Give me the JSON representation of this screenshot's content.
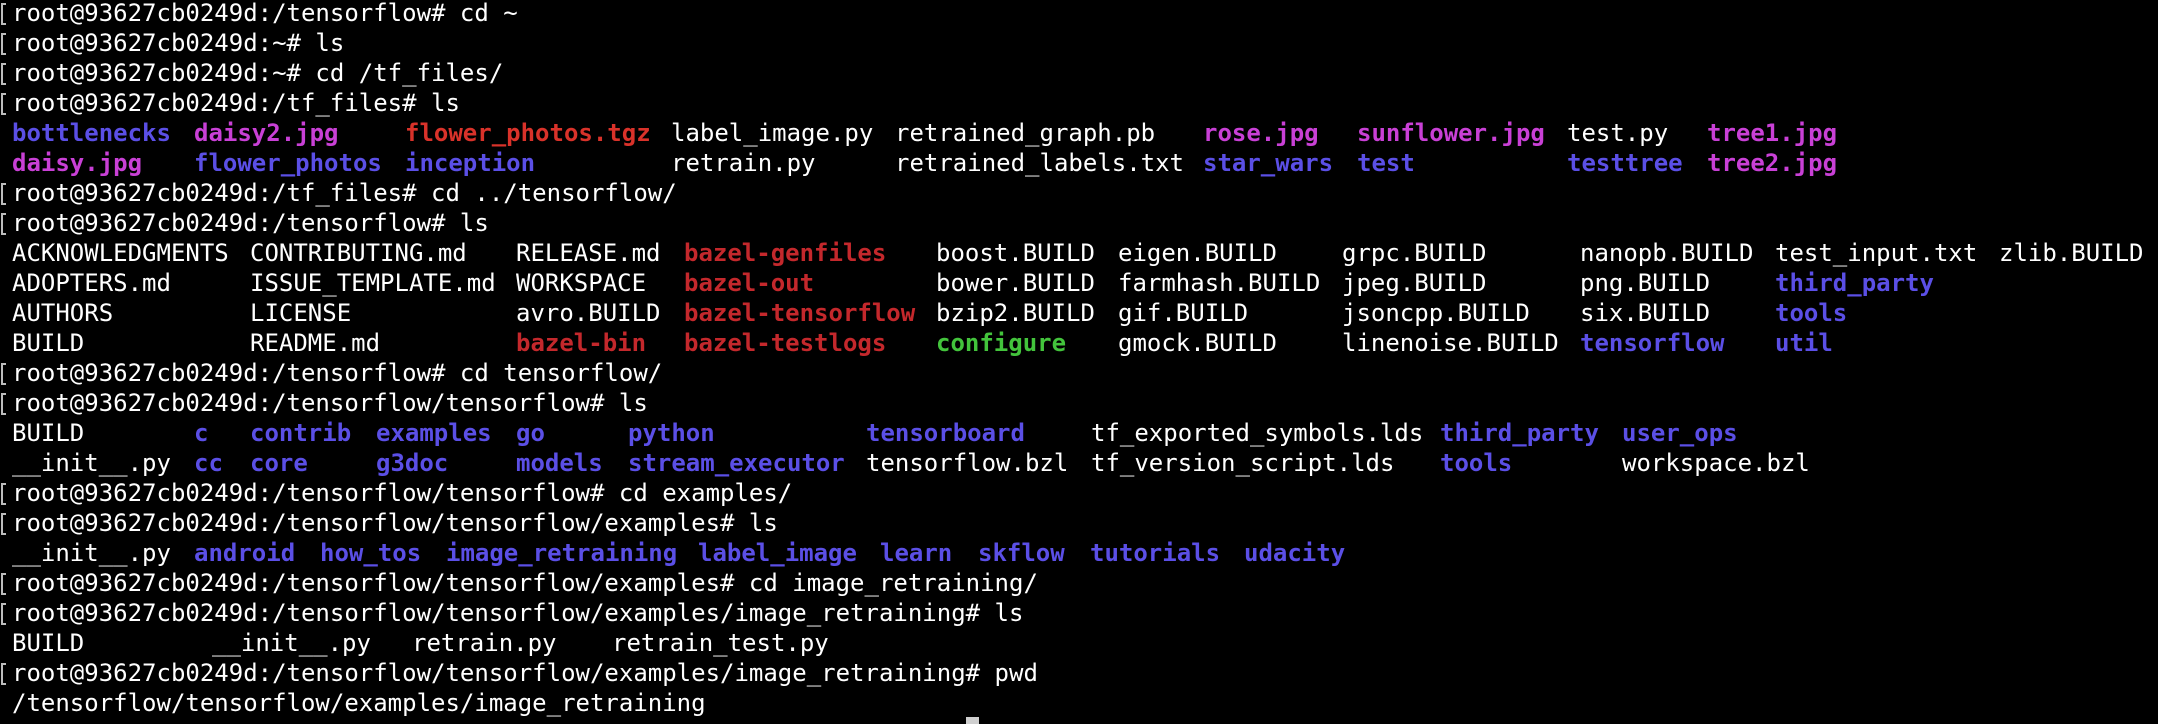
{
  "terminal": {
    "colors": {
      "background": "#000000",
      "text": "#ffffff",
      "directory": "#5b4fe6",
      "image": "#c940d6",
      "archive": "#d9322a",
      "symlink": "#c4282c",
      "executable": "#43c43c"
    },
    "lines": [
      {
        "kind": "prompt",
        "text": "root@93627cb0249d:/tensorflow# cd ~"
      },
      {
        "kind": "prompt",
        "text": "root@93627cb0249d:~# ls"
      },
      {
        "kind": "prompt",
        "text": "root@93627cb0249d:~# cd /tf_files/"
      },
      {
        "kind": "prompt",
        "text": "root@93627cb0249d:/tf_files# ls"
      },
      {
        "kind": "ls",
        "cells": [
          {
            "t": "bottlenecks",
            "c": "dir"
          },
          {
            "t": "daisy2.jpg",
            "c": "img"
          },
          {
            "t": "flower_photos.tgz",
            "c": "arc"
          },
          {
            "t": "label_image.py",
            "c": "file"
          },
          {
            "t": "retrained_graph.pb",
            "c": "file"
          },
          {
            "t": "rose.jpg",
            "c": "img"
          },
          {
            "t": "sunflower.jpg",
            "c": "img"
          },
          {
            "t": "test.py",
            "c": "file"
          },
          {
            "t": "tree1.jpg",
            "c": "img"
          }
        ]
      },
      {
        "kind": "ls",
        "cells": [
          {
            "t": "daisy.jpg",
            "c": "img"
          },
          {
            "t": "flower_photos",
            "c": "dir"
          },
          {
            "t": "inception",
            "c": "dir"
          },
          {
            "t": "retrain.py",
            "c": "file"
          },
          {
            "t": "retrained_labels.txt",
            "c": "file"
          },
          {
            "t": "star_wars",
            "c": "dir"
          },
          {
            "t": "test",
            "c": "dir"
          },
          {
            "t": "testtree",
            "c": "dir"
          },
          {
            "t": "tree2.jpg",
            "c": "img"
          }
        ]
      },
      {
        "kind": "prompt",
        "text": "root@93627cb0249d:/tf_files# cd ../tensorflow/"
      },
      {
        "kind": "prompt",
        "text": "root@93627cb0249d:/tensorflow# ls"
      },
      {
        "kind": "ls",
        "cells": [
          {
            "t": "ACKNOWLEDGMENTS",
            "c": "file"
          },
          {
            "t": "CONTRIBUTING.md",
            "c": "file"
          },
          {
            "t": "RELEASE.md",
            "c": "file"
          },
          {
            "t": "bazel-genfiles",
            "c": "lnk"
          },
          {
            "t": "boost.BUILD",
            "c": "file"
          },
          {
            "t": "eigen.BUILD",
            "c": "file"
          },
          {
            "t": "grpc.BUILD",
            "c": "file"
          },
          {
            "t": "nanopb.BUILD",
            "c": "file"
          },
          {
            "t": "test_input.txt",
            "c": "file"
          },
          {
            "t": "zlib.BUILD",
            "c": "file"
          }
        ]
      },
      {
        "kind": "ls",
        "cells": [
          {
            "t": "ADOPTERS.md",
            "c": "file"
          },
          {
            "t": "ISSUE_TEMPLATE.md",
            "c": "file"
          },
          {
            "t": "WORKSPACE",
            "c": "file"
          },
          {
            "t": "bazel-out",
            "c": "lnk"
          },
          {
            "t": "bower.BUILD",
            "c": "file"
          },
          {
            "t": "farmhash.BUILD",
            "c": "file"
          },
          {
            "t": "jpeg.BUILD",
            "c": "file"
          },
          {
            "t": "png.BUILD",
            "c": "file"
          },
          {
            "t": "third_party",
            "c": "dir"
          }
        ]
      },
      {
        "kind": "ls",
        "cells": [
          {
            "t": "AUTHORS",
            "c": "file"
          },
          {
            "t": "LICENSE",
            "c": "file"
          },
          {
            "t": "avro.BUILD",
            "c": "file"
          },
          {
            "t": "bazel-tensorflow",
            "c": "lnk"
          },
          {
            "t": "bzip2.BUILD",
            "c": "file"
          },
          {
            "t": "gif.BUILD",
            "c": "file"
          },
          {
            "t": "jsoncpp.BUILD",
            "c": "file"
          },
          {
            "t": "six.BUILD",
            "c": "file"
          },
          {
            "t": "tools",
            "c": "dir"
          }
        ]
      },
      {
        "kind": "ls",
        "cells": [
          {
            "t": "BUILD",
            "c": "file"
          },
          {
            "t": "README.md",
            "c": "file"
          },
          {
            "t": "bazel-bin",
            "c": "lnk"
          },
          {
            "t": "bazel-testlogs",
            "c": "lnk"
          },
          {
            "t": "configure",
            "c": "exe"
          },
          {
            "t": "gmock.BUILD",
            "c": "file"
          },
          {
            "t": "linenoise.BUILD",
            "c": "file"
          },
          {
            "t": "tensorflow",
            "c": "dir"
          },
          {
            "t": "util",
            "c": "dir"
          }
        ]
      },
      {
        "kind": "prompt",
        "text": "root@93627cb0249d:/tensorflow# cd tensorflow/"
      },
      {
        "kind": "prompt",
        "text": "root@93627cb0249d:/tensorflow/tensorflow# ls"
      },
      {
        "kind": "ls",
        "cells": [
          {
            "t": "BUILD",
            "c": "file"
          },
          {
            "t": "c",
            "c": "dir"
          },
          {
            "t": "contrib",
            "c": "dir"
          },
          {
            "t": "examples",
            "c": "dir"
          },
          {
            "t": "go",
            "c": "dir"
          },
          {
            "t": "python",
            "c": "dir"
          },
          {
            "t": "tensorboard",
            "c": "dir"
          },
          {
            "t": "tf_exported_symbols.lds",
            "c": "file"
          },
          {
            "t": "third_party",
            "c": "dir"
          },
          {
            "t": "user_ops",
            "c": "dir"
          }
        ]
      },
      {
        "kind": "ls",
        "cells": [
          {
            "t": "__init__.py",
            "c": "file"
          },
          {
            "t": "cc",
            "c": "dir"
          },
          {
            "t": "core",
            "c": "dir"
          },
          {
            "t": "g3doc",
            "c": "dir"
          },
          {
            "t": "models",
            "c": "dir"
          },
          {
            "t": "stream_executor",
            "c": "dir"
          },
          {
            "t": "tensorflow.bzl",
            "c": "file"
          },
          {
            "t": "tf_version_script.lds",
            "c": "file"
          },
          {
            "t": "tools",
            "c": "dir"
          },
          {
            "t": "workspace.bzl",
            "c": "file"
          }
        ]
      },
      {
        "kind": "prompt",
        "text": "root@93627cb0249d:/tensorflow/tensorflow# cd examples/"
      },
      {
        "kind": "prompt",
        "text": "root@93627cb0249d:/tensorflow/tensorflow/examples# ls"
      },
      {
        "kind": "ls",
        "cells": [
          {
            "t": "__init__.py",
            "c": "file"
          },
          {
            "t": "android",
            "c": "dir"
          },
          {
            "t": "how_tos",
            "c": "dir"
          },
          {
            "t": "image_retraining",
            "c": "dir"
          },
          {
            "t": "label_image",
            "c": "dir"
          },
          {
            "t": "learn",
            "c": "dir"
          },
          {
            "t": "skflow",
            "c": "dir"
          },
          {
            "t": "tutorials",
            "c": "dir"
          },
          {
            "t": "udacity",
            "c": "dir"
          }
        ]
      },
      {
        "kind": "prompt",
        "text": "root@93627cb0249d:/tensorflow/tensorflow/examples# cd image_retraining/"
      },
      {
        "kind": "prompt",
        "text": "root@93627cb0249d:/tensorflow/tensorflow/examples/image_retraining# ls"
      },
      {
        "kind": "ls",
        "cells": [
          {
            "t": "BUILD",
            "c": "file"
          },
          {
            "t": "__init__.py",
            "c": "file"
          },
          {
            "t": "retrain.py",
            "c": "file"
          },
          {
            "t": "retrain_test.py",
            "c": "file"
          }
        ]
      },
      {
        "kind": "prompt",
        "text": "root@93627cb0249d:/tensorflow/tensorflow/examples/image_retraining# pwd"
      },
      {
        "kind": "output",
        "text": "/tensorflow/tensorflow/examples/image_retraining"
      }
    ]
  }
}
